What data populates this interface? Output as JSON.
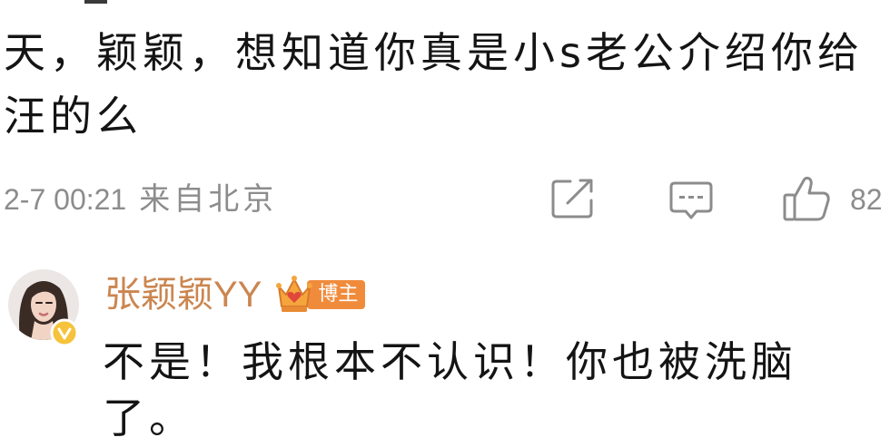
{
  "comment": {
    "text": "天，颖颖，想知道你真是小s老公介绍你给汪的么",
    "timestamp": "2-7 00:21",
    "location": "来自北京",
    "like_count": "82",
    "actions": [
      {
        "name": "share",
        "icon": "share-icon"
      },
      {
        "name": "comment",
        "icon": "comment-icon"
      },
      {
        "name": "like",
        "icon": "thumbs-up-icon"
      }
    ]
  },
  "reply": {
    "author": "张颖颖YY",
    "badge_label": "博主",
    "badge_icon": "crown-icon",
    "verified": true,
    "text": "不是！我根本不认识！你也被洗脑了。"
  },
  "colors": {
    "text": "#141414",
    "meta_gray": "#8c8c8c",
    "author_name": "#cb8650",
    "badge": "#f08b3c",
    "verified": "#f6c23a"
  }
}
